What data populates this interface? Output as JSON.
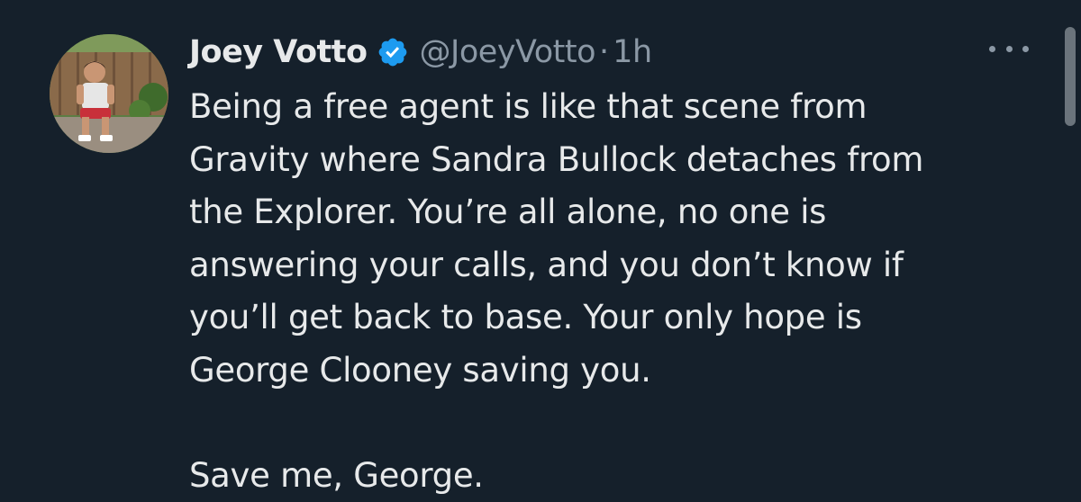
{
  "tweet": {
    "author": {
      "display_name": "Joey Votto",
      "handle": "@JoeyVotto",
      "verified": true
    },
    "separator": "·",
    "timestamp": "1h",
    "lines": [
      "Being a free agent is like that scene from",
      "Gravity where Sandra Bullock detaches from",
      "the Explorer. You’re all alone, no one is",
      "answering your calls, and you don’t know if",
      "you’ll get back to base. Your only hope is",
      "George Clooney saving you.",
      "",
      "Save me, George."
    ]
  },
  "icons": {
    "verified": "verified-badge-icon",
    "more": "more-options-icon"
  },
  "colors": {
    "background": "#15202b",
    "primary_text": "#e7e9ea",
    "secondary_text": "#8b98a5",
    "verified_blue": "#1d9bf0"
  }
}
